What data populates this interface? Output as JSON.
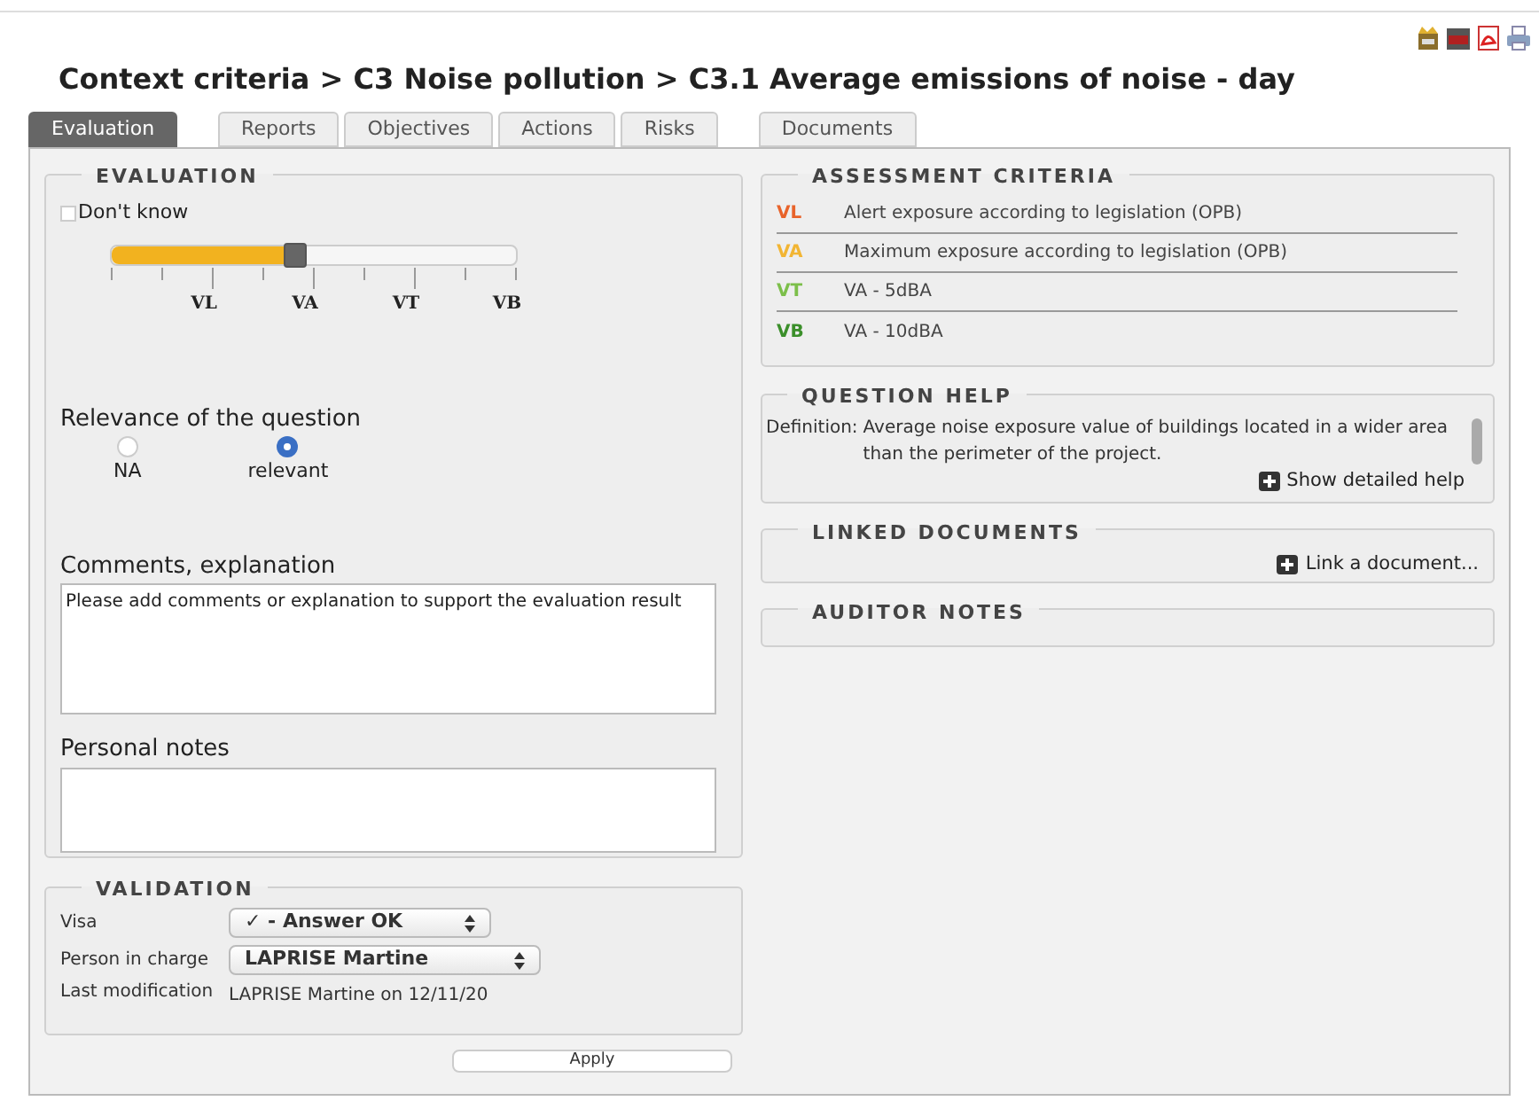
{
  "title": "Context criteria > C3 Noise pollution > C3.1 Average emissions of noise - day",
  "tabs": [
    {
      "label": "Evaluation",
      "selected": true
    },
    {
      "label": "Reports",
      "selected": false
    },
    {
      "label": "Objectives",
      "selected": false
    },
    {
      "label": "Actions",
      "selected": false
    },
    {
      "label": "Risks",
      "selected": false
    },
    {
      "label": "Documents",
      "selected": false
    }
  ],
  "evaluation": {
    "title": "EVALUATION",
    "dont_know": {
      "label": "Don't know",
      "checked": false
    },
    "slider": {
      "level": 0.45,
      "labels": [
        "VL",
        "VA",
        "VT",
        "VB"
      ]
    },
    "relevance": {
      "label": "Relevance of the question",
      "options": [
        {
          "label": "NA",
          "selected": false
        },
        {
          "label": "relevant",
          "selected": true
        }
      ]
    },
    "comments": {
      "label": "Comments, explanation",
      "placeholder": "Please add comments or explanation to support the evaluation result"
    },
    "notes": {
      "label": "Personal notes"
    }
  },
  "validation": {
    "title": "VALIDATION",
    "visa": {
      "label": "Visa",
      "value": "✓ - Answer OK"
    },
    "person": {
      "label": "Person in charge",
      "value": "LAPRISE Martine"
    },
    "last": {
      "label": "Last modification",
      "value": "LAPRISE Martine on 12/11/20"
    }
  },
  "apply": "Apply",
  "assessment": {
    "title": "ASSESSMENT CRITERIA",
    "rows": [
      {
        "code": "VL",
        "color": "#e8632a",
        "text": "Alert exposure according to legislation (OPB)"
      },
      {
        "code": "VA",
        "color": "#f2b533",
        "text": "Maximum exposure according to legislation (OPB)"
      },
      {
        "code": "VT",
        "color": "#7cbf4a",
        "text": "VA - 5dBA"
      },
      {
        "code": "VB",
        "color": "#3b8f2a",
        "text": "VA - 10dBA"
      }
    ]
  },
  "help": {
    "title": "QUESTION HELP",
    "label": "Definition:",
    "text": "Average noise exposure value of buildings located in a wider area than the perimeter of the project.",
    "link": "Show detailed help"
  },
  "linked": {
    "title": "LINKED DOCUMENTS",
    "link": "Link a document..."
  },
  "auditor": {
    "title": "AUDITOR NOTES"
  }
}
